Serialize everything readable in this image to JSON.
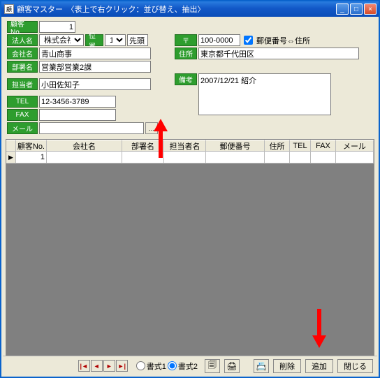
{
  "titlebar": {
    "title": "顧客マスター　〈表上で右クリック：並び替え、抽出〉"
  },
  "labels": {
    "cust_no": "顧客No.",
    "corp_type": "法人名",
    "title_pos": "位置",
    "company": "会社名",
    "dept": "部署名",
    "person": "担当者",
    "tel": "TEL",
    "fax": "FAX",
    "mail": "メール",
    "zip": "〒",
    "zip_to_addr": "郵便番号⇔住所",
    "address": "住所",
    "note": "備考"
  },
  "values": {
    "cust_no": "1",
    "corp_type": "株式会社",
    "title_pos": "1",
    "title_suffix": "先頭",
    "company": "青山商事",
    "dept": "営業部営業2課",
    "person": "小田佐知子",
    "tel": "12-3456-3789",
    "fax": "",
    "mail": "",
    "zip": "100-0000",
    "zip_to_addr_checked": true,
    "address": "東京都千代田区",
    "note": "2007/12/21 紹介"
  },
  "grid": {
    "headers": {
      "cust_no": "顧客No.",
      "company": "会社名",
      "dept": "部署名",
      "person": "担当者名",
      "zip": "郵便番号",
      "address": "住所",
      "tel": "TEL",
      "fax": "FAX",
      "mail": "メール"
    },
    "rows": [
      {
        "selector": "▶",
        "cust_no": "1",
        "company": "",
        "dept": "",
        "person": "",
        "zip": "",
        "address": "",
        "tel": "",
        "fax": "",
        "mail": ""
      }
    ]
  },
  "footer": {
    "format1": "書式1",
    "format2": "書式2",
    "delete": "削除",
    "add": "追加",
    "close": "閉じる"
  }
}
